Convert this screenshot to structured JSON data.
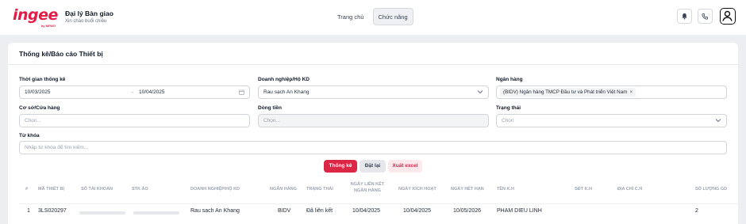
{
  "header": {
    "logo_text": "ingee",
    "logo_sub": "by NEWO",
    "brand_title": "Đại lý Bàn giao",
    "brand_subtitle": "Xin chào buổi chiều",
    "nav": [
      {
        "label": "Trang chủ",
        "active": false
      },
      {
        "label": "Chức năng",
        "active": true
      }
    ],
    "icons": [
      "bell-icon",
      "phone-icon",
      "user-icon"
    ]
  },
  "card": {
    "title": "Thống kê/Báo cáo Thiết bị"
  },
  "filters": {
    "time": {
      "label": "Thời gian thống kê",
      "from": "10/03/2025",
      "separator": "→",
      "to": "10/04/2025"
    },
    "business": {
      "label": "Doanh nghiệp/Hộ KD",
      "value": "Rau sạch An Khang"
    },
    "bank": {
      "label": "Ngân hàng",
      "tag": "(BIDV) Ngân hàng TMCP Đầu tư và Phát triển Việt Nam",
      "tag_close": "×"
    },
    "store": {
      "label": "Cơ sở/Cửa hàng",
      "placeholder": "Chọn..."
    },
    "cashflow": {
      "label": "Dòng tiền",
      "placeholder": "Chọn..."
    },
    "status": {
      "label": "Trạng thái",
      "placeholder": "Chọn"
    },
    "keyword": {
      "label": "Từ khóa",
      "placeholder": "Nhập từ khóa để tìm kiếm..."
    }
  },
  "actions": {
    "stats": "Thống kê",
    "reset": "Đặt lại",
    "export": "Xuất excel"
  },
  "table": {
    "headers": {
      "index": "#",
      "device_code": "MÃ THIẾT BỊ",
      "account_no": "SỐ TÀI KHOẢN",
      "virtual_acc": "STK ẢO",
      "business": "DOANH NGHIỆP/HỘ KD",
      "bank": "NGÂN HÀNG",
      "status": "TRẠNG THÁI",
      "link_date_1": "NGÀY LIÊN KẾT",
      "link_date_2": "NGÂN HÀNG",
      "activate_date": "NGÀY KÍCH HOẠT",
      "expire_date": "NGÀY HẾT HẠN",
      "customer_name": "TÊN K.H",
      "phone": "SĐT K.H",
      "address": "ĐỊA CHỈ C.H",
      "quantity": "SỐ LƯỢNG GD"
    },
    "rows": [
      {
        "index": "1",
        "device_code": "3LS020297",
        "business": "Rau sạch An Khang",
        "bank": "BIDV",
        "status": "Đã liên kết",
        "link_date": "10/04/2025",
        "activate_date": "10/04/2025",
        "expire_date": "10/05/2026",
        "customer_name": "PHAM DIEU LINH",
        "quantity": "2"
      }
    ]
  }
}
